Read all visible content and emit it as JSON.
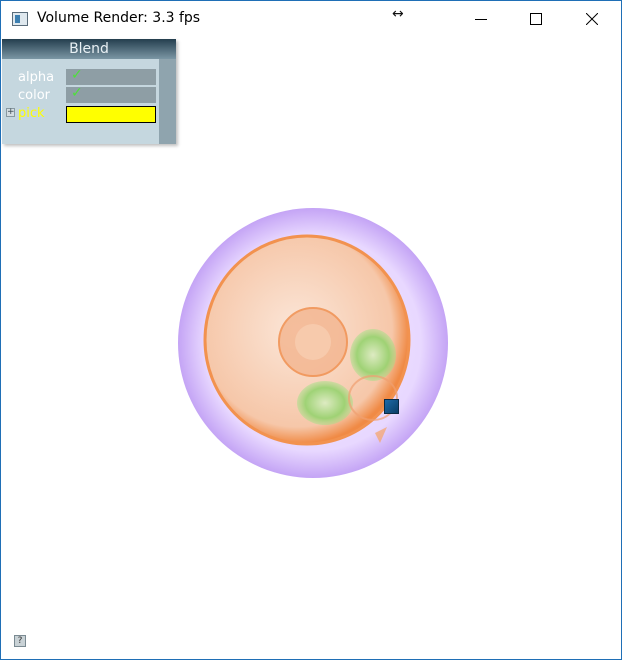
{
  "window": {
    "title": "Volume Render: 3.3 fps",
    "resize_glyph": "↔",
    "controls": [
      "minimize",
      "maximize",
      "close"
    ]
  },
  "panel": {
    "title": "Blend",
    "rows": [
      {
        "label": "alpha",
        "checked": true,
        "check_glyph": "✓"
      },
      {
        "label": "color",
        "checked": true,
        "check_glyph": "✓"
      },
      {
        "label": "pick",
        "swatch_color": "#ffff00",
        "label_color": "#ffff00"
      }
    ],
    "expand_glyph": "+"
  },
  "render": {
    "handle_color": "#1f6aa8"
  },
  "help_glyph": "?"
}
